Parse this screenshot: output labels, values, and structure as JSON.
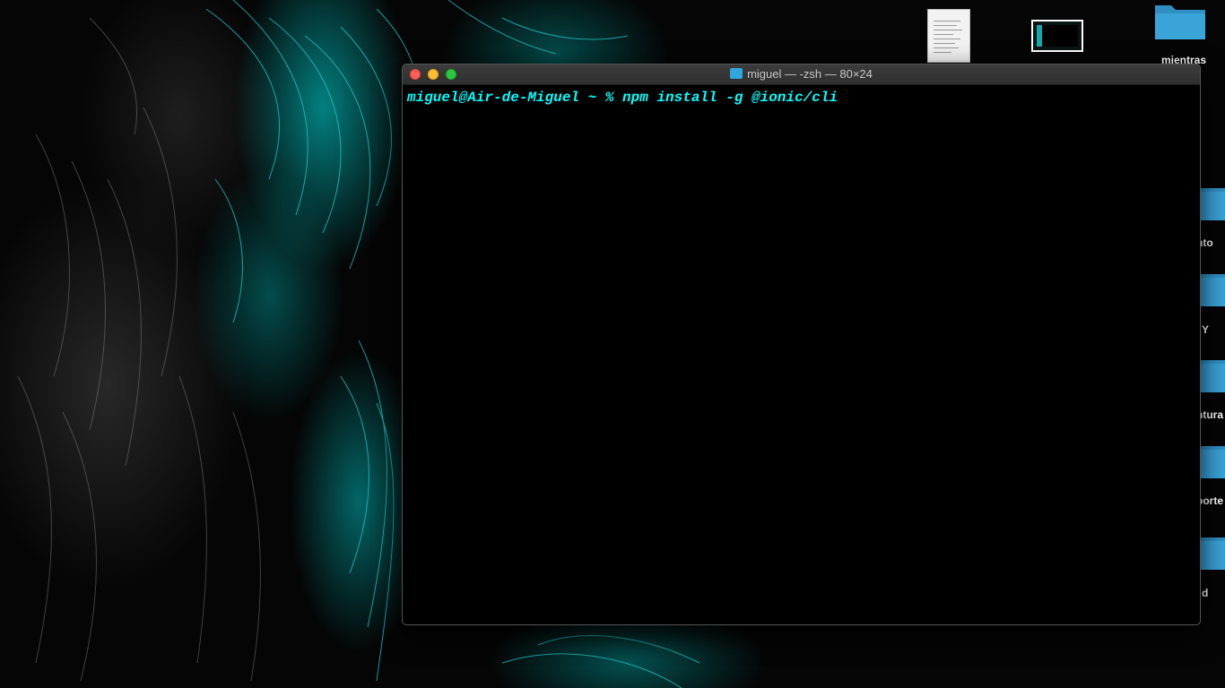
{
  "desktop": {
    "icons_top": [
      {
        "name": "document",
        "label": ""
      },
      {
        "name": "screenshot",
        "label": ""
      },
      {
        "name": "folder",
        "label": "mientras"
      }
    ],
    "icons_side": [
      {
        "label": "nto"
      },
      {
        "label": "Y"
      },
      {
        "label": "ntura"
      },
      {
        "label": "porte"
      },
      {
        "label": "d"
      }
    ],
    "folder_color": "#3aa3d8"
  },
  "terminal": {
    "title": "miguel — -zsh — 80×24",
    "title_icon": "folder-icon",
    "prompt_line": "miguel@Air-de-Miguel ~ % npm install -g @ionic/cli",
    "text_color": "#00ffff",
    "background": "#000000"
  }
}
